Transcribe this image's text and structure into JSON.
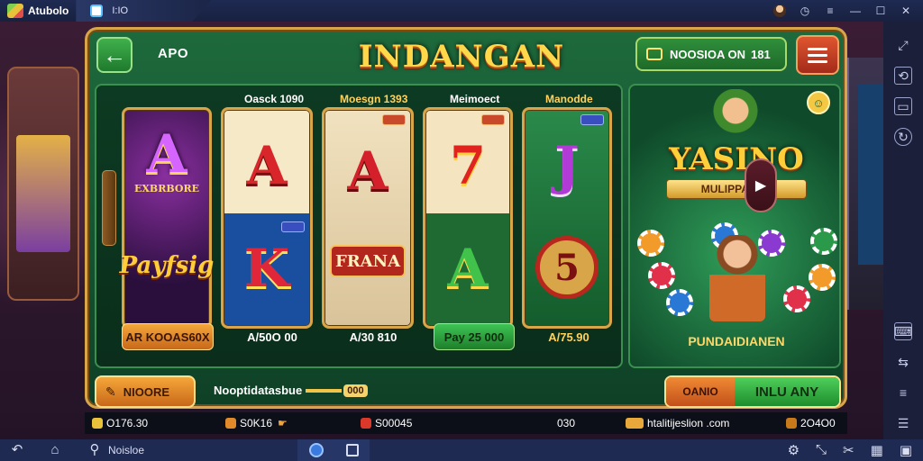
{
  "titlebar": {
    "app_name": "Atubolo",
    "tab_label": "I:IO",
    "icons": [
      "avatar-icon",
      "clock-icon",
      "menu-icon",
      "minimize-icon",
      "maximize-icon",
      "close-icon"
    ]
  },
  "game": {
    "header": {
      "back_icon": "back-arrow-icon",
      "label": "APO",
      "title": "INDANGAN",
      "pill_text": "NOOSIOA ON",
      "pill_value": "181",
      "menu_icon": "hamburger-icon"
    },
    "reels": {
      "headers": [
        "Oasck 1090",
        "Moesgn 1393",
        "Meimoect",
        "Manodde"
      ],
      "columns": [
        {
          "top_symbol": "A",
          "top_caption": "EXBRBORE",
          "bottom_symbol": "Payfsig"
        },
        {
          "top_symbol": "A",
          "bottom_symbol": "K"
        },
        {
          "top_symbol": "A",
          "bottom_symbol": "FRANA"
        },
        {
          "top_symbol": "7",
          "bottom_symbol": "A"
        },
        {
          "top_symbol": "J",
          "bottom_symbol": "5"
        }
      ],
      "bets": [
        "AR KOOAS60X",
        "A/50O 00",
        "A/30 810",
        "Pay 25 000",
        "A/75.90"
      ]
    },
    "promo": {
      "title": "YASINO",
      "banner": "MULIPPANNE",
      "subtitle": "PUNDAIDIANEN"
    },
    "actions": {
      "left_button": "NIOORE",
      "middle_text": "Nooptidatasbue",
      "middle_badge": "000",
      "right_left": "OANIO",
      "right_main": "INLU ANY"
    },
    "status": {
      "balance": "O176.30",
      "slot": "S0K16",
      "coins": "S00045",
      "count": "030",
      "site": "htalitijeslion .com",
      "time": "2O4O0"
    }
  },
  "navbar": {
    "label": "Noisloe",
    "icons": [
      "back-icon",
      "home-icon",
      "search-icon",
      "app-icon",
      "window-icon",
      "settings-icon",
      "expand-icon",
      "scissors-icon",
      "grid-icon",
      "fullscreen-icon"
    ]
  },
  "sidebar": {
    "icons": [
      "expand-icon",
      "rotate-icon",
      "screen-icon",
      "sync-icon",
      "keyboard-icon",
      "volume-icon",
      "more-icon",
      "shake-icon"
    ]
  },
  "colors": {
    "frame_gold": "#d8a548",
    "felt_green": "#1e6a3c",
    "title_yellow": "#ffd84a",
    "menu_red": "#e0552f"
  }
}
